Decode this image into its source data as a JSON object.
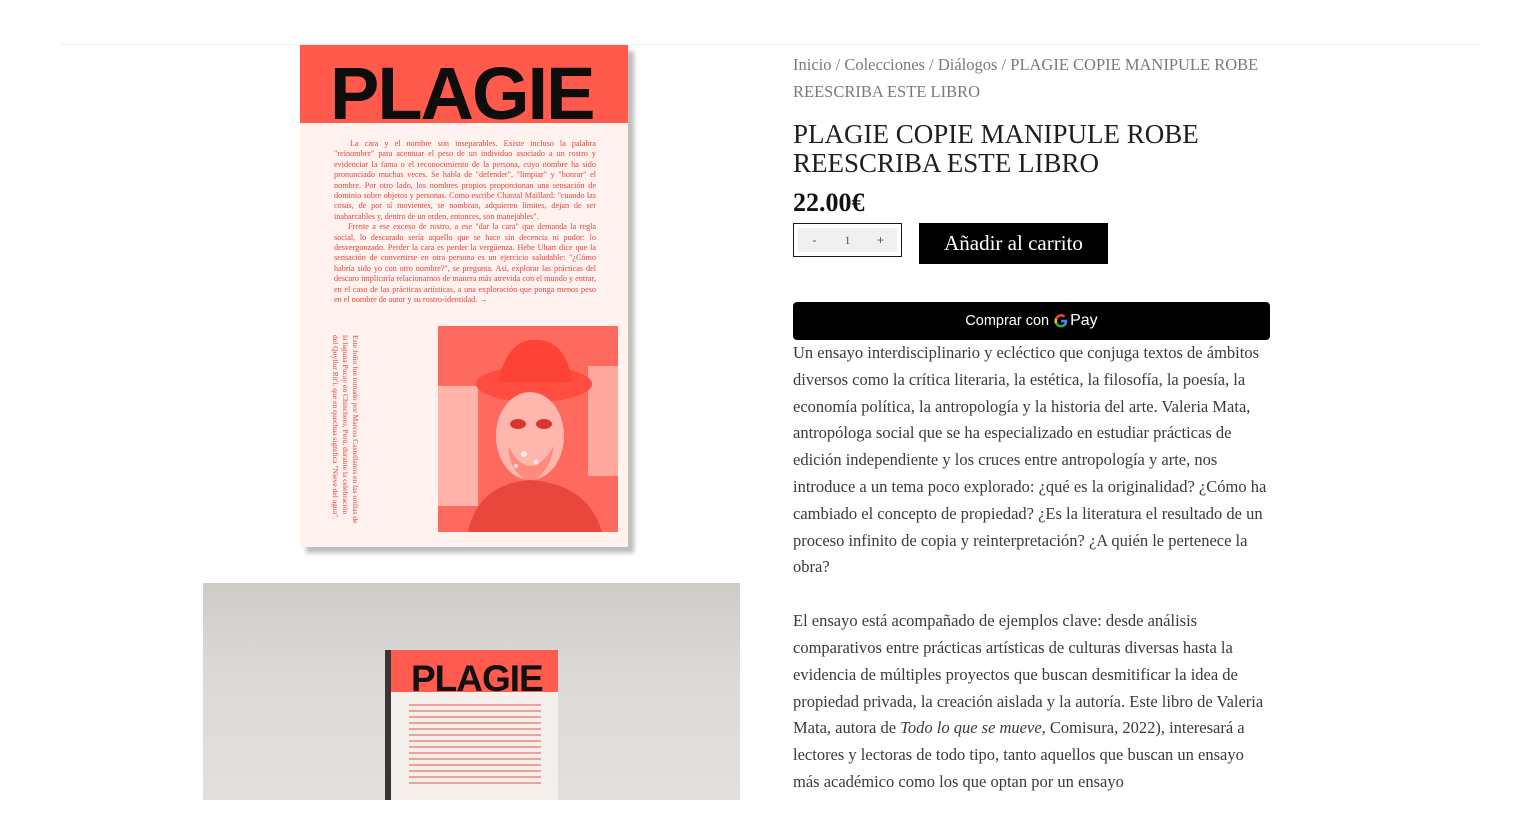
{
  "cover": {
    "title": "PLAGIE",
    "paragraph_1": "La cara y el nombre son inseparables. Existe incluso la palabra \"reinombre\" para acentuar el peso de un individuo asociado a un rostro y evidenciar la fama o el reconocimiento de la persona, cuyo nombre ha sido pronunciado muchas veces. Se habla de \"defender\", \"limpiar\" y \"honrar\" el nombre. Por otro lado, los nombres propios proporcionan una sensación de dominio sobre objetos y personas. Como escribe Chantal Maillard: \"cuando las cosas, de por sí movientes, se nombran, adquieren límites, dejan de ser inabarcables y, dentro de un orden, entonces, son manejables\".",
    "paragraph_2": "Frente a ese exceso de rostro, a ese \"dar la cara\" que demanda la regla social, lo descarado sería aquello que se hace sin decencia ni pudor: lo desvergonzado. Perder la cara es perder la vergüenza. Hebe Uhart dice que la sensación de convertirse en otra persona es un ejercicio saludable: \"¿Cómo habría sido yo con otro nombre?\", se pregunta. Así, explorar las prácticas del descaro implicaría relacionarnos de manera más atrevida con el mundo y entrar, en el caso de las prácticas artísticas, a una exploración que ponga menos peso en el nombre de autor y su rostro-identidad. →",
    "side_text": "Este folio fue tomado por Marcos Castellanos en las orillas de la laguna Pucay en Chinchero, Perú, durante la celebración del Qoyllur Rit'i, que en quechua significa \"Nieve del agua\"."
  },
  "photo": {
    "book_title": "PLAGIE"
  },
  "breadcrumb": {
    "items": [
      "Inicio",
      "Colecciones",
      "Diálogos"
    ],
    "current": "PLAGIE COPIE MANIPULE ROBE REESCRIBA ESTE LIBRO",
    "separator": "/"
  },
  "product": {
    "title": "PLAGIE COPIE MANIPULE ROBE REESCRIBA ESTE LIBRO",
    "price": "22.00€"
  },
  "quantity": {
    "minus": "-",
    "value": "1",
    "plus": "+"
  },
  "add_to_cart": "Añadir al carrito",
  "gpay": {
    "label": "Comprar con",
    "pay": "Pay"
  },
  "description": {
    "p1": "Un ensayo interdisciplinario y ecléctico que conjuga textos de ámbitos diversos como la crítica literaria, la estética, la filosofía, la poesía, la economía política, la antropología y la historia del arte. Valeria Mata, antropóloga social que se ha especializado en estudiar prácticas de edición independiente y los cruces entre antropología y arte, nos introduce a un tema poco explorado: ¿qué es la originalidad? ¿Cómo ha cambiado el concepto de propiedad? ¿Es la literatura el resultado de un proceso infinito de copia y reinterpretación? ¿A quién le pertenece la obra?",
    "p2_start": "El ensayo está acompañado de ejemplos clave: desde análisis comparativos entre prácticas artísticas de culturas diversas hasta la evidencia de múltiples proyectos que buscan desmitificar la idea de propiedad privada, la creación aislada y la autoría. Este libro de Valeria Mata, autora de ",
    "p2_italic": "Todo lo que se mueve",
    "p2_end": ", Comisura, 2022), interesará a lectores y lectoras de todo tipo, tanto aquellos que buscan un ensayo más académico como los que optan por un ensayo"
  }
}
